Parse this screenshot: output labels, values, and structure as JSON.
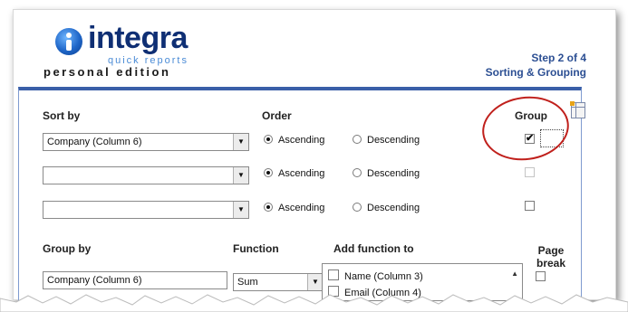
{
  "logo": {
    "name": "integra",
    "sub": "quick reports",
    "edition": "personal edition"
  },
  "step": {
    "label": "Step 2 of 4",
    "title": "Sorting & Grouping"
  },
  "sort": {
    "label": "Sort by",
    "order_label": "Order",
    "group_label": "Group",
    "rows": [
      {
        "value": "Company (Column 6)",
        "ascending_label": "Ascending",
        "descending_label": "Descending",
        "order": "ascending",
        "group": true
      },
      {
        "value": "",
        "ascending_label": "Ascending",
        "descending_label": "Descending",
        "order": "ascending",
        "group": false
      },
      {
        "value": "",
        "ascending_label": "Ascending",
        "descending_label": "Descending",
        "order": "ascending",
        "group": false
      }
    ]
  },
  "grouping": {
    "group_by_label": "Group by",
    "group_by_value": "Company (Column 6)",
    "function_label": "Function",
    "function_value": "Sum",
    "add_function_label": "Add function to",
    "page_break_label": "Page break",
    "columns": [
      {
        "label": "Name (Column 3)"
      },
      {
        "label": "Email (Column 4)"
      }
    ]
  },
  "icons": {
    "dropdown": "chevron-down-icon",
    "grid": "table-grid-icon"
  },
  "colors": {
    "brand": "#0f2f74",
    "accent": "#2c4f93",
    "panel_border": "#3a5fa8",
    "highlight": "#c0201c"
  }
}
